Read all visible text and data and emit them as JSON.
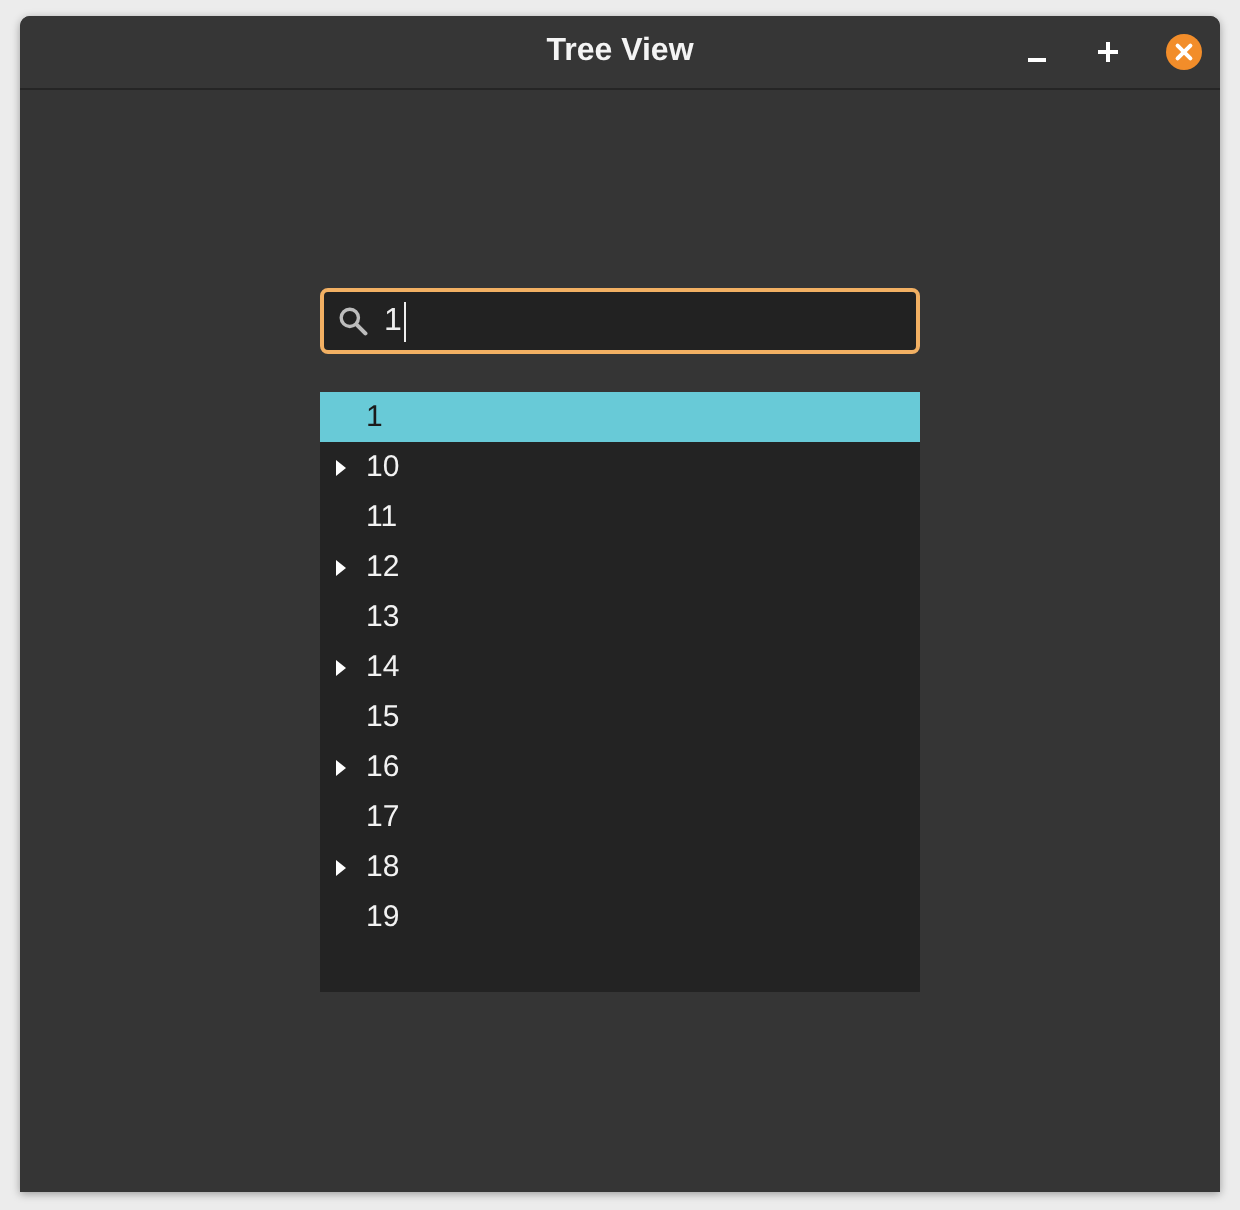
{
  "window": {
    "title": "Tree View"
  },
  "search": {
    "value": "1",
    "focused": true
  },
  "tree": {
    "rows": [
      {
        "label": "1",
        "kind": "leaf",
        "selected": true
      },
      {
        "label": "10",
        "kind": "branch",
        "expanded": false,
        "selected": false
      },
      {
        "label": "11",
        "kind": "leaf",
        "selected": false
      },
      {
        "label": "12",
        "kind": "branch",
        "expanded": false,
        "selected": false
      },
      {
        "label": "13",
        "kind": "leaf",
        "selected": false
      },
      {
        "label": "14",
        "kind": "branch",
        "expanded": false,
        "selected": false
      },
      {
        "label": "15",
        "kind": "leaf",
        "selected": false
      },
      {
        "label": "16",
        "kind": "branch",
        "expanded": false,
        "selected": false
      },
      {
        "label": "17",
        "kind": "leaf",
        "selected": false
      },
      {
        "label": "18",
        "kind": "branch",
        "expanded": false,
        "selected": false
      },
      {
        "label": "19",
        "kind": "leaf",
        "selected": false
      }
    ]
  }
}
